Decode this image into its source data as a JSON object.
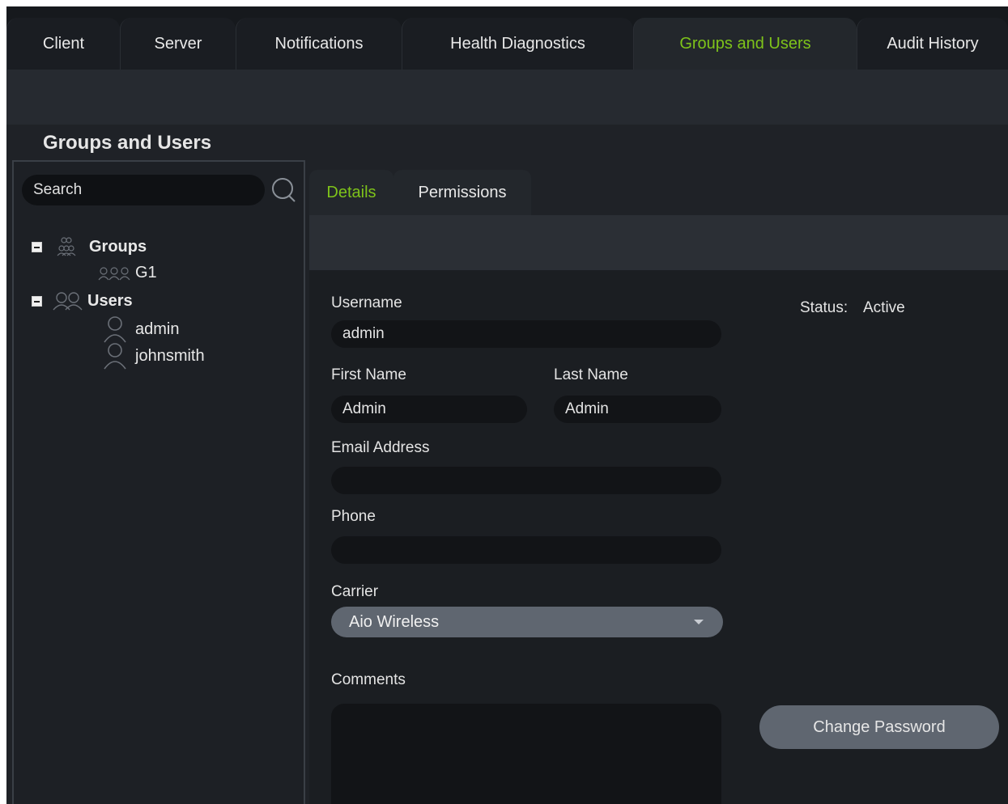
{
  "top_tabs": [
    {
      "label": "Client"
    },
    {
      "label": "Server"
    },
    {
      "label": "Notifications"
    },
    {
      "label": "Health Diagnostics"
    },
    {
      "label": "Groups and Users"
    },
    {
      "label": "Audit History"
    }
  ],
  "active_top_tab": "Groups and Users",
  "section": {
    "title": "Groups and Users"
  },
  "sidebar": {
    "search_placeholder": "Search",
    "tree": {
      "groups_label": "Groups",
      "groups": [
        "G1"
      ],
      "users_label": "Users",
      "users": [
        "admin",
        "johnsmith"
      ]
    }
  },
  "detail_tabs": [
    {
      "label": "Details"
    },
    {
      "label": "Permissions"
    }
  ],
  "active_detail_tab": "Details",
  "form": {
    "username_label": "Username",
    "username_value": "admin",
    "first_name_label": "First Name",
    "first_name_value": "Admin",
    "last_name_label": "Last Name",
    "last_name_value": "Admin",
    "email_label": "Email Address",
    "email_value": "",
    "phone_label": "Phone",
    "phone_value": "",
    "carrier_label": "Carrier",
    "carrier_value": "Aio Wireless",
    "comments_label": "Comments",
    "comments_value": "",
    "status_label": "Status:",
    "status_value": "Active",
    "change_password_label": "Change Password"
  },
  "colors": {
    "accent_green": "#7ec31a",
    "background": "#1f2227",
    "button": "#5f6670"
  }
}
